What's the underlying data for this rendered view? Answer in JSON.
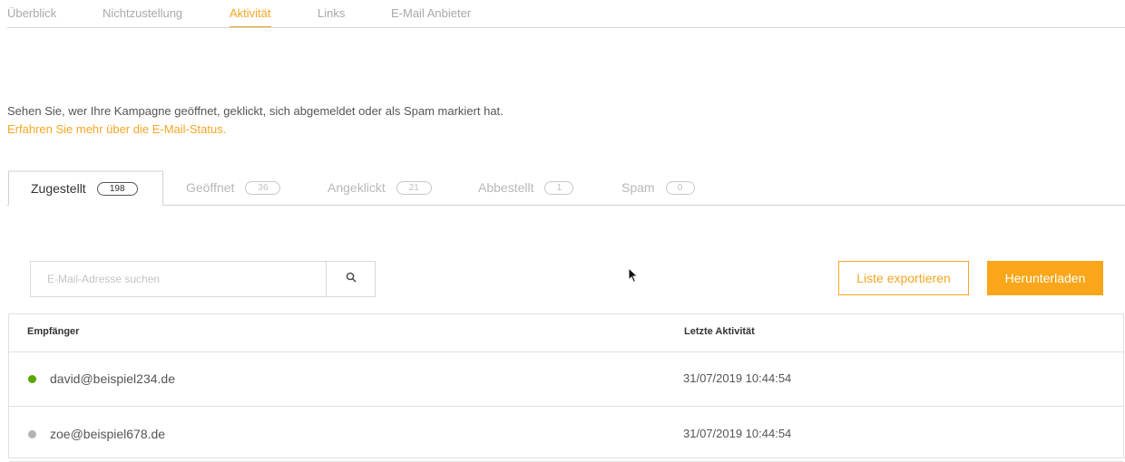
{
  "top_nav": {
    "items": [
      "Überblick",
      "Nichtzustellung",
      "Aktivität",
      "Links",
      "E-Mail Anbieter"
    ],
    "active": "Aktivität"
  },
  "intro": {
    "text": "Sehen Sie, wer Ihre Kampagne geöffnet, geklickt, sich abgemeldet oder als Spam markiert hat.",
    "link": "Erfahren Sie mehr über die E-Mail-Status."
  },
  "tabs": [
    {
      "label": "Zugestellt",
      "count": "198"
    },
    {
      "label": "Geöffnet",
      "count": "36"
    },
    {
      "label": "Angeklickt",
      "count": "21"
    },
    {
      "label": "Abbestellt",
      "count": "1"
    },
    {
      "label": "Spam",
      "count": "0"
    }
  ],
  "active_tab": "Zugestellt",
  "search": {
    "placeholder": "E-Mail-Adresse suchen",
    "value": "",
    "icon": "search-icon"
  },
  "actions": {
    "export_label": "Liste exportieren",
    "download_label": "Herunterladen"
  },
  "table": {
    "headers": [
      "Empfänger",
      "Letzte Aktivität"
    ],
    "rows": [
      {
        "email": "david@beispiel234.de",
        "date": "31/07/2019 10:44:54",
        "status_color": "#5aa600"
      },
      {
        "email": "zoe@beispiel678.de",
        "date": "31/07/2019 10:44:54",
        "status_color": "#b3b3b3"
      }
    ]
  },
  "colors": {
    "accent": "#f5a623",
    "button_fill": "#f9a61a"
  }
}
